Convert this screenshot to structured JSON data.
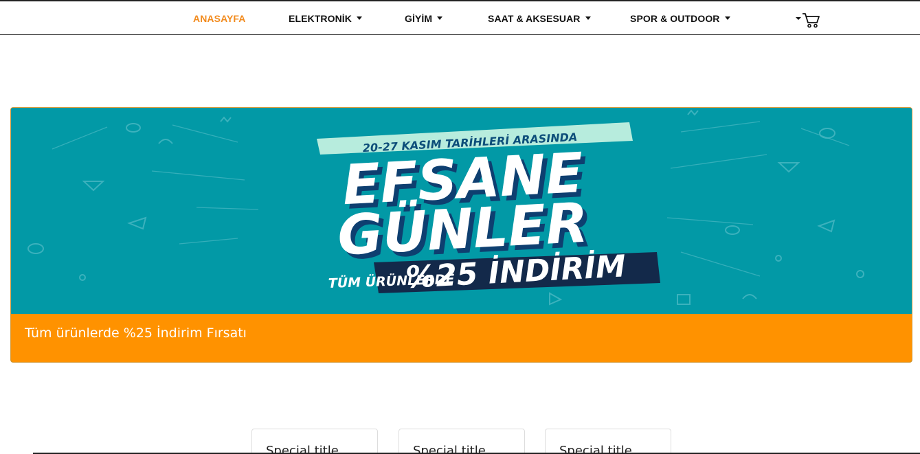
{
  "nav": {
    "items": [
      {
        "label": "ANASAYFA",
        "active": true,
        "dropdown": false
      },
      {
        "label": "ELEKTRONİK",
        "active": false,
        "dropdown": true
      },
      {
        "label": "GİYİM",
        "active": false,
        "dropdown": true
      },
      {
        "label": "SAAT & AKSESUAR",
        "active": false,
        "dropdown": true
      },
      {
        "label": "SPOR & OUTDOOR",
        "active": false,
        "dropdown": true
      }
    ],
    "cart_icon": "cart-icon",
    "accent_color": "#f28b1e"
  },
  "banner": {
    "ribbon_text": "20-27 KASIM TARİHLERİ ARASINDA",
    "headline_1": "EFSANE",
    "headline_2": "GÜNLER",
    "subline": "TÜM ÜRÜNLERDE",
    "discount": "%25 İNDİRİM",
    "caption": "Tüm ürünlerde %25 İndirim Fırsatı",
    "background_color": "#0299a6",
    "caption_bar_color": "#ff9200"
  },
  "cards": [
    {
      "title": "Special title"
    },
    {
      "title": "Special title"
    },
    {
      "title": "Special title"
    }
  ]
}
